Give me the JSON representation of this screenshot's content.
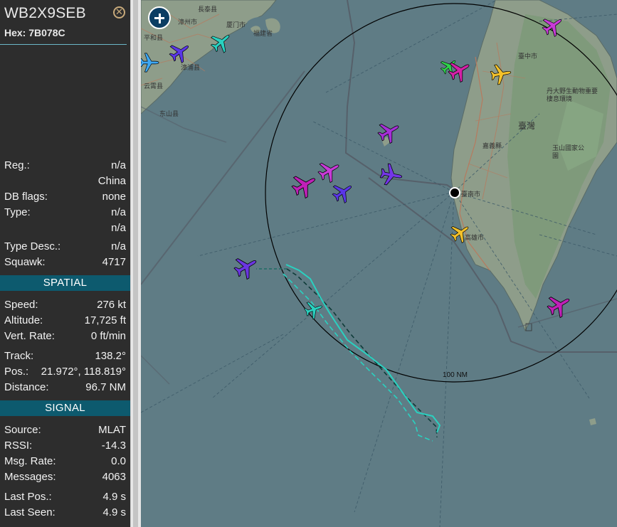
{
  "aircraft": {
    "callsign": "WB2X9SEB",
    "hex_label": "Hex: 7B078C",
    "close_icon": "close-icon"
  },
  "details": [
    {
      "key": "Reg.:",
      "value": "n/a"
    },
    {
      "key": "",
      "value": "China"
    },
    {
      "key": "DB flags:",
      "value": "none"
    },
    {
      "key": "Type:",
      "value": "n/a"
    },
    {
      "key": "",
      "value": "n/a"
    },
    {
      "key": "Type Desc.:",
      "value": "n/a"
    },
    {
      "key": "Squawk:",
      "value": "4717"
    }
  ],
  "spatial": {
    "heading": "SPATIAL",
    "rows": [
      {
        "key": "Speed:",
        "value": "276 kt"
      },
      {
        "key": "Altitude:",
        "value": "17,725 ft"
      },
      {
        "key": "Vert. Rate:",
        "value": "0 ft/min"
      },
      {
        "key": "Track:",
        "value": "138.2°"
      },
      {
        "key": "Pos.:",
        "value": "21.972°, 118.819°"
      },
      {
        "key": "Distance:",
        "value": "96.7 NM"
      }
    ]
  },
  "signal": {
    "heading": "SIGNAL",
    "rows": [
      {
        "key": "Source:",
        "value": "MLAT"
      },
      {
        "key": "RSSI:",
        "value": "-14.3"
      },
      {
        "key": "Msg. Rate:",
        "value": "0.0"
      },
      {
        "key": "Messages:",
        "value": "4063"
      },
      {
        "key": "Last Pos.:",
        "value": "4.9 s"
      },
      {
        "key": "Last Seen:",
        "value": "4.9 s"
      }
    ]
  },
  "map": {
    "range_ring_label": "100 NM",
    "place_labels": [
      "長泰县",
      "漳州市",
      "厦门市",
      "福建省",
      "平和县",
      "漳浦县",
      "云霄县",
      "东山县",
      "臺中市",
      "臺灣",
      "臺南市",
      "丹大野生動物重要棲息環境",
      "玉山國家公園",
      "嘉義縣",
      "高雄市"
    ],
    "zoom_icon": "plus-icon",
    "colors": {
      "sea": "#5f7c85",
      "land": "#8e9d8a",
      "selected_track": "#2ad1c0",
      "range_ring": "#000000"
    }
  }
}
